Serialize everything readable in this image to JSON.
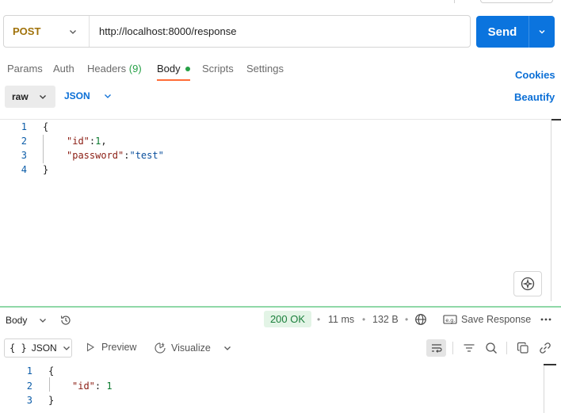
{
  "request": {
    "method": "POST",
    "url": "http://localhost:8000/response",
    "send_label": "Send"
  },
  "tabs": {
    "params": "Params",
    "auth": "Auth",
    "headers": "Headers",
    "headers_count": "(9)",
    "body": "Body",
    "scripts": "Scripts",
    "settings": "Settings",
    "active": "Body"
  },
  "links": {
    "cookies": "Cookies",
    "beautify": "Beautify"
  },
  "body_options": {
    "mode": "raw",
    "language": "JSON"
  },
  "request_body": {
    "line_numbers": [
      "1",
      "2",
      "3",
      "4"
    ],
    "open_brace": "{",
    "close_brace": "}",
    "id_key": "\"id\"",
    "id_value": "1",
    "password_key": "\"password\"",
    "password_value": "\"test\"",
    "colon": ":",
    "comma": ","
  },
  "response": {
    "body_label": "Body",
    "status": "200 OK",
    "time": "11 ms",
    "size": "132 B",
    "save_label": "Save Response",
    "more_icon": "ellipsis-icon",
    "view_mode": "JSON",
    "view_mode_brace": "{ }",
    "preview_label": "Preview",
    "visualize_label": "Visualize",
    "line_numbers": [
      "1",
      "2",
      "3"
    ],
    "open_brace": "{",
    "close_brace": "}",
    "id_key": "\"id\"",
    "id_value": "1",
    "separator": "•",
    "status_color": "#1a7f3b"
  },
  "colors": {
    "accent": "#0b74de",
    "method": "#a0720a",
    "active_tab_underline": "#ff6c37",
    "success": "#26a046"
  }
}
